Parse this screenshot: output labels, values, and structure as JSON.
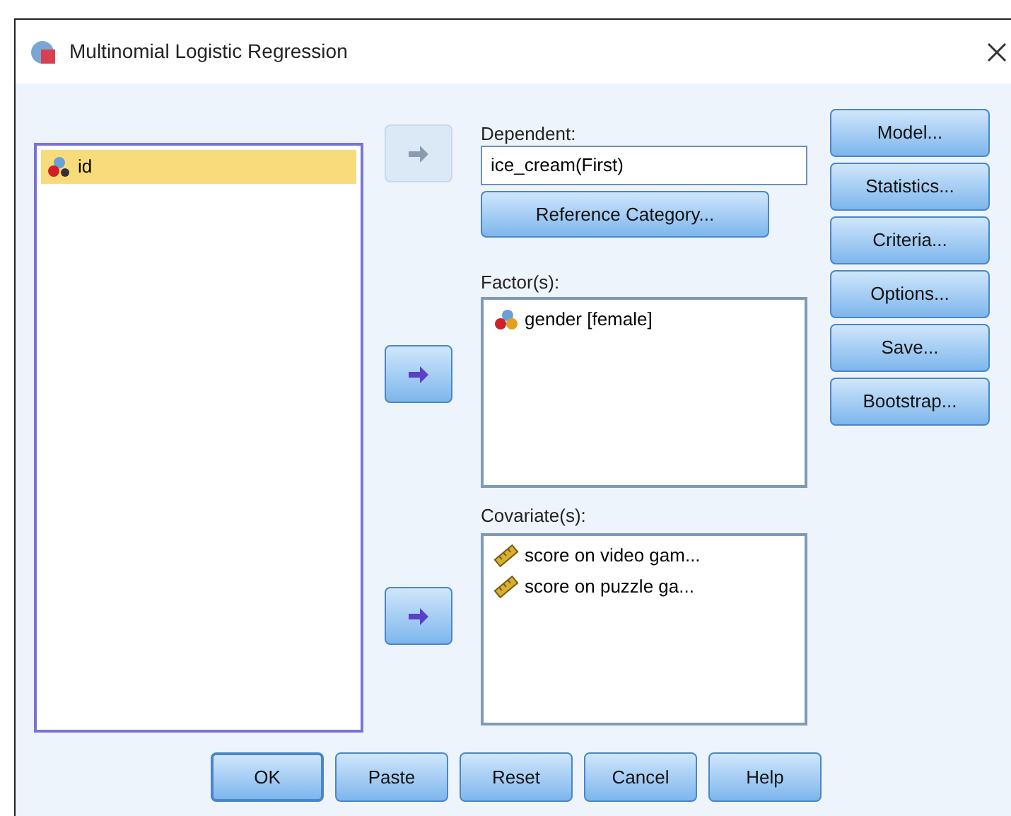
{
  "window": {
    "title": "Multinomial Logistic Regression"
  },
  "variables": [
    {
      "label": "id",
      "kind": "string",
      "selected": true
    }
  ],
  "arrows": [
    {
      "disabled": true
    },
    {
      "disabled": false
    },
    {
      "disabled": false
    }
  ],
  "dependent": {
    "label": "Dependent:",
    "value": "ice_cream(First)",
    "button": "Reference Category..."
  },
  "factors": {
    "label": "Factor(s):",
    "items": [
      {
        "label": "gender [female]",
        "kind": "nominal"
      }
    ]
  },
  "covariates": {
    "label": "Covariate(s):",
    "items": [
      {
        "label": "score on video gam...",
        "kind": "scale"
      },
      {
        "label": "score on puzzle ga...",
        "kind": "scale"
      }
    ]
  },
  "side_buttons": [
    "Model...",
    "Statistics...",
    "Criteria...",
    "Options...",
    "Save...",
    "Bootstrap..."
  ],
  "bottom_buttons": [
    {
      "label": "OK",
      "default": true
    },
    {
      "label": "Paste",
      "default": false
    },
    {
      "label": "Reset",
      "default": false
    },
    {
      "label": "Cancel",
      "default": false
    },
    {
      "label": "Help",
      "default": false
    }
  ]
}
